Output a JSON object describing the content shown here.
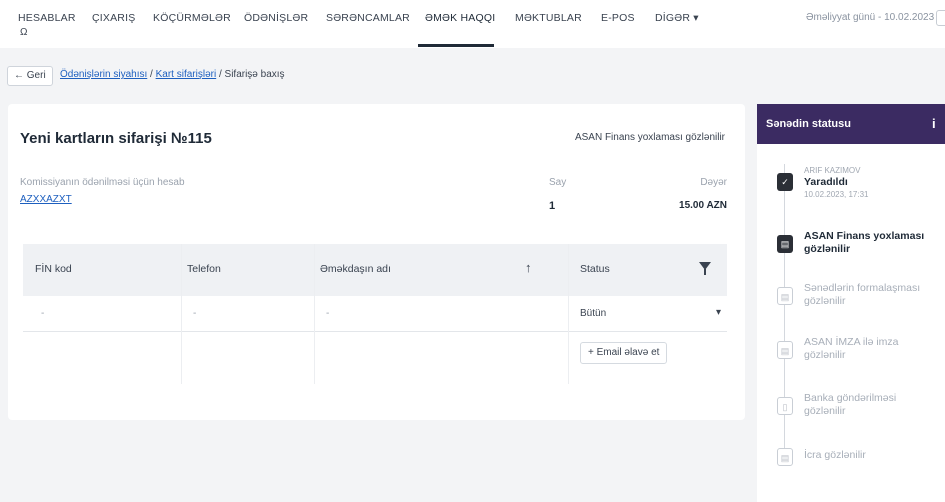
{
  "nav": {
    "items": [
      {
        "label": "HESABLAR"
      },
      {
        "label": "ÇIXARIŞ"
      },
      {
        "label": "KÖÇÜRMƏLƏR"
      },
      {
        "label": "ÖDƏNİŞLƏR"
      },
      {
        "label": "SƏRƏNCAMLAR"
      },
      {
        "label": "ƏMƏK HAQQI"
      },
      {
        "label": "MƏKTUBLAR"
      },
      {
        "label": "E-POS"
      },
      {
        "label": "DİGƏR ▾"
      }
    ],
    "sub_icon": "Ω",
    "operational_date": "Əməliyyat günü - 10.02.2023"
  },
  "breadcrumb": {
    "back_label": "← Geri",
    "link1": "Ödənişlərin siyahısı",
    "sep": " / ",
    "link2": "Kart sifarişləri",
    "current": " / Sifarişə baxış"
  },
  "order": {
    "title": "Yeni kartların sifarişi №115",
    "status_text": "ASAN Finans yoxlaması gözlənilir",
    "account_label": "Komissiyanın ödənilməsi üçün hesab",
    "account_value": "AZXXAZXT",
    "count_label": "Say",
    "count_value": "1",
    "amount_label": "Dəyər",
    "amount_value": "15.00 AZN"
  },
  "table": {
    "columns": [
      "FİN kod",
      "Telefon",
      "Əməkdaşın adı",
      "Status"
    ],
    "sort_icon": "↑",
    "rows": [
      {
        "fin": "-",
        "phone": "-",
        "name": "-",
        "status": "Bütün"
      }
    ],
    "chevron": "▾",
    "email_button": "+ Email əlavə et"
  },
  "status_panel": {
    "title": "Sənədin statusu",
    "info_icon": "i",
    "steps": [
      {
        "meta": "ARIF KAZIMOV",
        "label": "Yaradıldı",
        "date": "10.02.2023, 17:31",
        "done": true
      },
      {
        "label": "ASAN Finans yoxlaması gözlənilir",
        "done": true
      },
      {
        "label": "Sənədlərin formalaşması gözlənilir",
        "done": false
      },
      {
        "label": "ASAN İMZA ilə imza gözlənilir",
        "done": false
      },
      {
        "label": "Banka göndərilməsi gözlənilir",
        "done": false
      },
      {
        "label": "İcra gözlənilir",
        "done": false
      }
    ]
  },
  "colors": {
    "panel_header": "#3b2b62",
    "link": "#1d5fbf"
  }
}
